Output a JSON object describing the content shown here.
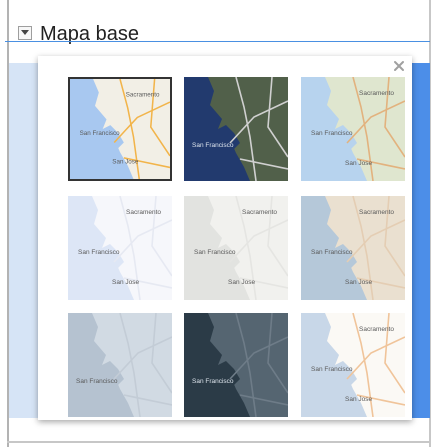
{
  "panel": {
    "title": "Mapa base",
    "close_symbol": "×"
  },
  "basemaps": [
    {
      "id": "streets",
      "selected": true,
      "water": "#a8c8f0",
      "land": "#f2efe6",
      "road": "#f2b44a",
      "labels": [
        "Sacramento",
        "San Francisco",
        "San Jose"
      ]
    },
    {
      "id": "imagery",
      "selected": false,
      "water": "#223a6e",
      "land": "#51604a",
      "road": "#d0d0d0",
      "labels": [
        "San Francisco"
      ]
    },
    {
      "id": "topographic",
      "selected": false,
      "water": "#b7d3ee",
      "land": "#dfe6cf",
      "road": "#e2b27e",
      "labels": [
        "Sacramento",
        "San Francisco",
        "San Jose"
      ]
    },
    {
      "id": "light-gray-blue",
      "selected": false,
      "water": "#dde6f6",
      "land": "#f6f7fb",
      "road": "#e6e9f2",
      "labels": [
        "Sacramento",
        "San Francisco",
        "San Jose"
      ]
    },
    {
      "id": "light-gray",
      "selected": false,
      "water": "#e2e3e0",
      "land": "#f1f1ee",
      "road": "#e5e5e2",
      "labels": [
        "Sacramento",
        "San Francisco",
        "San Jose"
      ]
    },
    {
      "id": "oceans",
      "selected": false,
      "water": "#b5c8d9",
      "land": "#eae0d0",
      "road": "#e4cdb3",
      "labels": [
        "Sacramento",
        "San Francisco",
        "San Jose"
      ]
    },
    {
      "id": "gray-blue",
      "selected": false,
      "water": "#b5c2d0",
      "land": "#d1dae3",
      "road": "#c3ccd6",
      "labels": [
        "San Francisco"
      ]
    },
    {
      "id": "dark-gray",
      "selected": false,
      "water": "#2b3b47",
      "land": "#556571",
      "road": "#6e7c88",
      "labels": [
        "San Francisco"
      ]
    },
    {
      "id": "streets-light",
      "selected": false,
      "water": "#c8d7e8",
      "land": "#fbf9f5",
      "road": "#f0c49a",
      "labels": [
        "Sacramento",
        "San Francisco",
        "San Jose"
      ]
    }
  ]
}
